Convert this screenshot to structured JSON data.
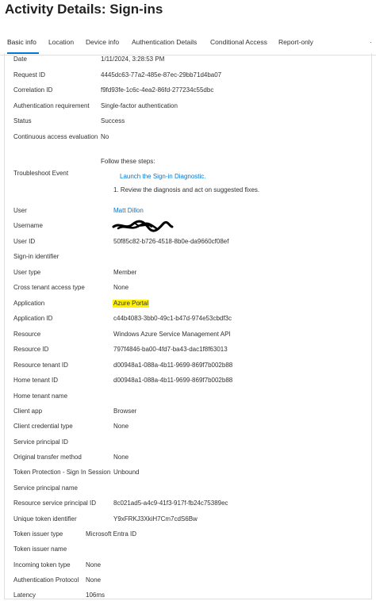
{
  "title": "Activity Details: Sign-ins",
  "tabs": [
    {
      "label": "Basic info"
    },
    {
      "label": "Location"
    },
    {
      "label": "Device info"
    },
    {
      "label": "Authentication Details"
    },
    {
      "label": "Conditional Access"
    },
    {
      "label": "Report-only"
    }
  ],
  "rows": {
    "date": {
      "label": "Date",
      "value": "1/11/2024, 3:28:53 PM"
    },
    "request_id": {
      "label": "Request ID",
      "value": "4445dc63-77a2-485e-87ec-29bb71d4ba07"
    },
    "correlation_id": {
      "label": "Correlation ID",
      "value": "f9fd93fe-1c6c-4ea2-86fd-277234c55dbc"
    },
    "auth_requirement": {
      "label": "Authentication requirement",
      "value": "Single-factor authentication"
    },
    "status": {
      "label": "Status",
      "value": "Success"
    },
    "continuous_access": {
      "label": "Continuous access evaluation",
      "value": "No"
    },
    "troubleshoot": {
      "label": "Troubleshoot Event",
      "intro": "Follow these steps:",
      "link": "Launch the Sign-in Diagnostic.",
      "step": "1. Review the diagnosis and act on suggested fixes."
    },
    "user": {
      "label": "User",
      "value": "Matt Dillon"
    },
    "username": {
      "label": "Username",
      "value": ""
    },
    "user_id": {
      "label": "User ID",
      "value": "50f85c82-b726-4518-8b0e-da9660cf08ef"
    },
    "signin_identifier": {
      "label": "Sign-in identifier",
      "value": ""
    },
    "user_type": {
      "label": "User type",
      "value": "Member"
    },
    "cross_tenant": {
      "label": "Cross tenant access type",
      "value": "None"
    },
    "application": {
      "label": "Application",
      "value": "Azure Portal"
    },
    "application_id": {
      "label": "Application ID",
      "value": "c44b4083-3bb0-49c1-b47d-974e53cbdf3c"
    },
    "resource": {
      "label": "Resource",
      "value": "Windows Azure Service Management API"
    },
    "resource_id": {
      "label": "Resource ID",
      "value": "797f4846-ba00-4fd7-ba43-dac1f8f63013"
    },
    "resource_tenant_id": {
      "label": "Resource tenant ID",
      "value": "d00948a1-088a-4b11-9699-869f7b002b88"
    },
    "home_tenant_id": {
      "label": "Home tenant ID",
      "value": "d00948a1-088a-4b11-9699-869f7b002b88"
    },
    "home_tenant_name": {
      "label": "Home tenant name",
      "value": ""
    },
    "client_app": {
      "label": "Client app",
      "value": "Browser"
    },
    "client_credential_type": {
      "label": "Client credential type",
      "value": "None"
    },
    "service_principal_id": {
      "label": "Service principal ID",
      "value": ""
    },
    "original_transfer": {
      "label": "Original transfer method",
      "value": "None"
    },
    "token_protection": {
      "label": "Token Protection - Sign In Session",
      "value": "Unbound"
    },
    "service_principal_name": {
      "label": "Service principal name",
      "value": ""
    },
    "resource_sp_id": {
      "label": "Resource service principal ID",
      "value": "8c021ad5-a4c9-41f3-917f-fb24c75389ec"
    },
    "unique_token_id": {
      "label": "Unique token identifier",
      "value": "Y9xFRKJ3XkiH7Cm7cdS6Bw"
    },
    "token_issuer_type": {
      "label": "Token issuer type",
      "value": "Microsoft Entra ID"
    },
    "token_issuer_name": {
      "label": "Token issuer name",
      "value": ""
    },
    "incoming_token_type": {
      "label": "Incoming token type",
      "value": "None"
    },
    "auth_protocol": {
      "label": "Authentication Protocol",
      "value": "None"
    },
    "latency": {
      "label": "Latency",
      "value": "106ms"
    }
  },
  "colors": {
    "link": "#0078d4",
    "highlight": "#fff100",
    "tab_underline": "#0078d4"
  }
}
